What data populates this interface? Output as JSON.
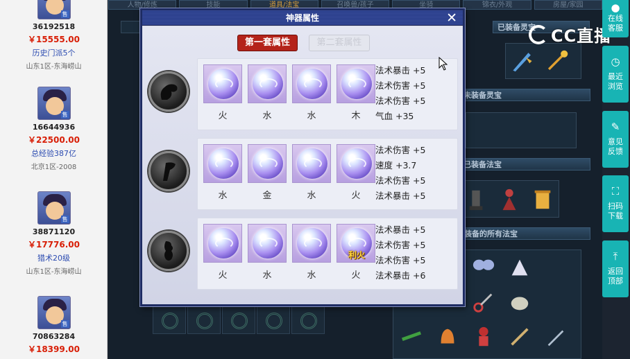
{
  "sellers": [
    {
      "id": "36192518",
      "price": "￥15555.00",
      "note": "历史门派5个",
      "server": "山东1区-东海崂山"
    },
    {
      "id": "16644936",
      "price": "￥22500.00",
      "note": "总经验387亿",
      "server": "北京1区-2008"
    },
    {
      "id": "38871120",
      "price": "￥17776.00",
      "note": "猎术20级",
      "server": "山东1区-东海崂山"
    },
    {
      "id": "70863284",
      "price": "￥18399.00"
    }
  ],
  "game_bg": {
    "tabs": [
      "人物/修炼",
      "技能",
      "道具/法宝",
      "召唤兽/孩子",
      "坐骑",
      "锦衣/外观",
      "房屋/家园"
    ],
    "head_1": "已装备灵宝",
    "head_2": "未装备灵宝",
    "head_3": "已装备法宝",
    "head_4": "未装备的所有法宝"
  },
  "watermark": {
    "text": "CC直播"
  },
  "right_bar": [
    {
      "icon": "chat-icon",
      "label_1": "在线",
      "label_2": "客服"
    },
    {
      "icon": "clock-icon",
      "label_1": "最近",
      "label_2": "浏览"
    },
    {
      "icon": "edit-icon",
      "label_1": "意见",
      "label_2": "反馈"
    },
    {
      "icon": "scan-icon",
      "label_1": "扫码",
      "label_2": "下载"
    },
    {
      "icon": "arrow-up-icon",
      "label_1": "返回",
      "label_2": "顶部"
    }
  ],
  "dialog": {
    "title": "神器属性",
    "close": "✕",
    "tabs": {
      "set1": "第一套属性",
      "set2": "第二套属性"
    },
    "groups": [
      {
        "gems": [
          {
            "element": "火"
          },
          {
            "element": "水"
          },
          {
            "element": "水"
          },
          {
            "element": "木"
          }
        ],
        "attrs": [
          "法术暴击 +5",
          "法术伤害 +5",
          "法术伤害 +5",
          "气血 +35"
        ]
      },
      {
        "gems": [
          {
            "element": "水"
          },
          {
            "element": "金"
          },
          {
            "element": "水"
          },
          {
            "element": "火"
          }
        ],
        "attrs": [
          "法术伤害 +5",
          "速度 +3.7",
          "法术伤害 +5",
          "法术暴击 +5"
        ]
      },
      {
        "gems": [
          {
            "element": "火"
          },
          {
            "element": "水"
          },
          {
            "element": "水"
          },
          {
            "element": "火",
            "special": "利火"
          }
        ],
        "attrs": [
          "法术暴击 +5",
          "法术伤害 +5",
          "法术伤害 +5",
          "法术暴击 +6"
        ]
      }
    ]
  },
  "colors": {
    "accent_red": "#b4231a",
    "title_blue": "#253a86",
    "sidebar_teal": "#18b4b4",
    "price_red": "#d81e06"
  }
}
